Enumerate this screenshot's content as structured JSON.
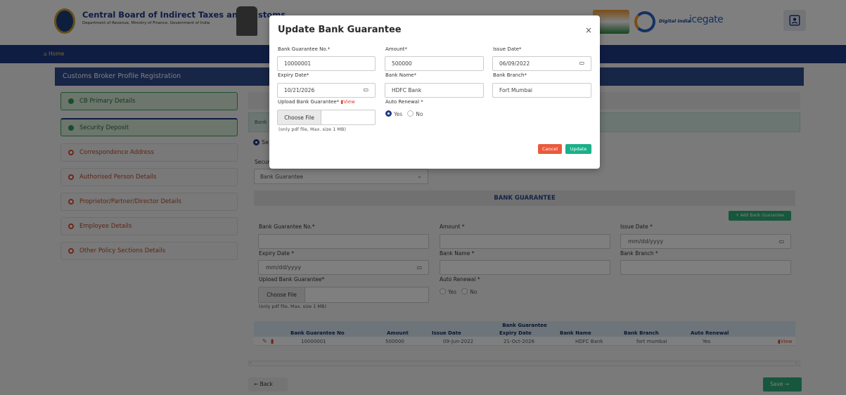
{
  "header": {
    "org_title": "Central Board of Indirect Taxes and Customs",
    "org_subtitle": "Department of Revenue, Ministry of Finance, Government of India",
    "digital_india": "Digital India",
    "icegate": "icegate",
    "profile_icon": "user-card-icon"
  },
  "navbar": {
    "home": "⌂ Home"
  },
  "page": {
    "title": "Customs Broker Profile Registration",
    "sidebar": [
      {
        "label": "CB Primary Details",
        "status": "done"
      },
      {
        "label": "Security Deposit",
        "status": "active"
      },
      {
        "label": "Correspondence Address",
        "status": "pending"
      },
      {
        "label": "Authorised Person Details",
        "status": "pending"
      },
      {
        "label": "Proprietor/Partner/Director Details",
        "status": "pending"
      },
      {
        "label": "Employee Details",
        "status": "pending"
      },
      {
        "label": "Other Policy Sections Details",
        "status": "pending"
      }
    ],
    "info_strip": "Bank",
    "security_radio": "Se",
    "security_type_label": "Secur",
    "security_select": "Bank Guarantee",
    "section_heading": "BANK GUARANTEE",
    "add_button": "+ Add Bank Guarantee",
    "form": {
      "bg_no_label": "Bank Guarantee No.*",
      "amount_label": "Amount *",
      "issue_date_label": "Issue Date *",
      "issue_date_placeholder": "mm/dd/yyyy",
      "expiry_label": "Expiry Date *",
      "expiry_placeholder": "mm/dd/yyyy",
      "bank_name_label": "Bank Name *",
      "bank_branch_label": "Bank Branch *",
      "upload_label": "Upload Bank Guarantee*",
      "choose_file": "Choose File",
      "hint": "(only pdf file, Max. size 1 MB)",
      "auto_renewal_label": "Auto Renewal *",
      "yes": "Yes",
      "no": "No"
    },
    "table": {
      "caption": "Bank Guarantee",
      "headers": [
        "Bank Guarantee No",
        "Amount",
        "Issue Date",
        "Expiry Date",
        "Bank Name",
        "Bank Branch",
        "Auto Renewal"
      ],
      "rows": [
        {
          "bg_no": "10000001",
          "amount": "500000",
          "issue": "09-Jun-2022",
          "expiry": "21-Oct-2026",
          "bank": "HDFC Bank",
          "branch": "fort mumbai",
          "renewal": "Yes",
          "view": "View"
        }
      ]
    },
    "back": "←  Back",
    "save": "Save  →"
  },
  "modal": {
    "title": "Update Bank Guarantee",
    "close": "×",
    "bg_no_label": "Bank Guarantee No.*",
    "bg_no_value": "10000001",
    "amount_label": "Amount*",
    "amount_value": "500000",
    "issue_date_label": "Issue Date*",
    "issue_date_value": "06/09/2022",
    "expiry_label": "Expiry Date*",
    "expiry_value": "10/21/2026",
    "bank_name_label": "Bank Name*",
    "bank_name_value": "HDFC Bank",
    "bank_branch_label": "Bank Branch*",
    "bank_branch_value": "Fort Mumbai",
    "upload_label": "Upload Bank Guarantee*",
    "view_link": "View",
    "auto_renewal_label": "Auto Renewal *",
    "yes": "Yes",
    "no": "No",
    "choose_file": "Choose File",
    "hint": "(only pdf file, Max. size 1 MB)",
    "cancel": "Cancel",
    "update": "Update"
  },
  "colors": {
    "navy": "#1f3b86",
    "green": "#2fae7a",
    "red": "#ea5a3c"
  }
}
